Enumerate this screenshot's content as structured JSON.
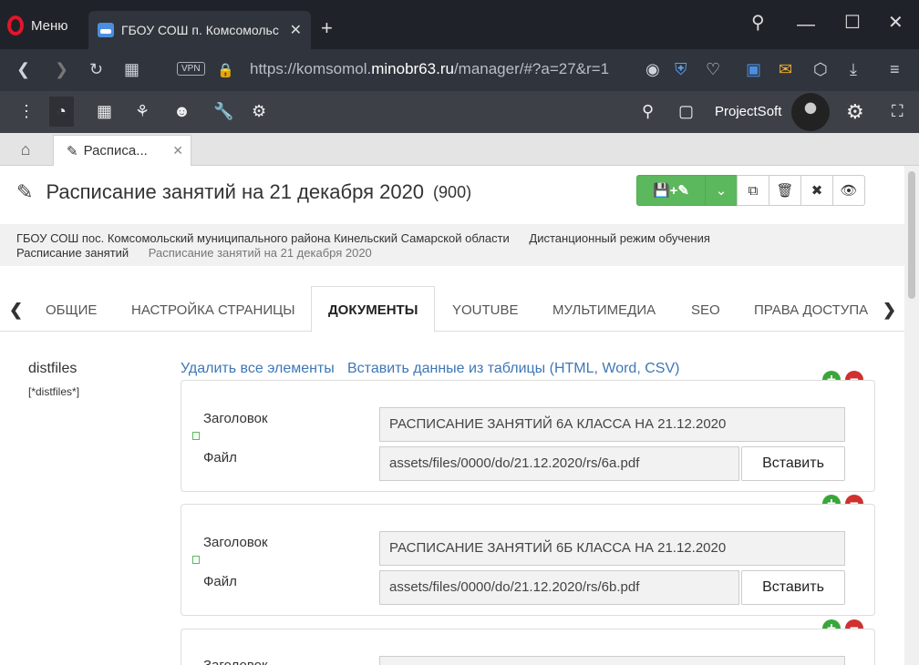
{
  "browser": {
    "menu_label": "Меню",
    "tab_title": "ГБОУ СОШ п. Комсомольс",
    "tab_close": "✕",
    "new_tab": "+",
    "url_prefix": "https://komsomol.",
    "url_domain": "minobr63.ru",
    "url_path": "/manager/#?a=27&r=1",
    "vpn_label": "VPN"
  },
  "navbar": {
    "user_name": "ProjectSoft"
  },
  "inner_tabs": {
    "doc_tab_label": "Расписа...",
    "close": "✕"
  },
  "page": {
    "title": "Расписание занятий на 21 декабря 2020",
    "id": "(900)"
  },
  "breadcrumbs": {
    "items": [
      "ГБОУ СОШ пос. Комсомольский муниципального района Кинельский Самарской области",
      "Дистанционный режим обучения",
      "Расписание занятий",
      "Расписание занятий на 21 декабря 2020"
    ]
  },
  "section_tabs": [
    "ОБЩИЕ",
    "НАСТРОЙКА СТРАНИЦЫ",
    "ДОКУМЕНТЫ",
    "YOUTUBE",
    "МУЛЬТИМЕДИА",
    "SEO",
    "ПРАВА ДОСТУПА"
  ],
  "active_section_tab": "ДОКУМЕНТЫ",
  "field": {
    "label": "distfiles",
    "key": "[*distfiles*]",
    "delete_all": "Удалить все элементы",
    "paste_table": "Вставить данные из таблицы (HTML, Word, CSV)"
  },
  "rows": [
    {
      "title_label": "Заголовок",
      "title_value": "РАСПИСАНИЕ ЗАНЯТИЙ 6А КЛАССА НА 21.12.2020",
      "file_label": "Файл",
      "file_value": "assets/files/0000/do/21.12.2020/rs/6a.pdf",
      "insert_label": "Вставить"
    },
    {
      "title_label": "Заголовок",
      "title_value": "РАСПИСАНИЕ ЗАНЯТИЙ 6Б КЛАССА НА 21.12.2020",
      "file_label": "Файл",
      "file_value": "assets/files/0000/do/21.12.2020/rs/6b.pdf",
      "insert_label": "Вставить"
    },
    {
      "title_label": "Заголовок"
    }
  ],
  "colors": {
    "success": "#5cb85c",
    "danger": "#d03030",
    "link": "#3e77b5",
    "navbar": "#3d4047"
  }
}
